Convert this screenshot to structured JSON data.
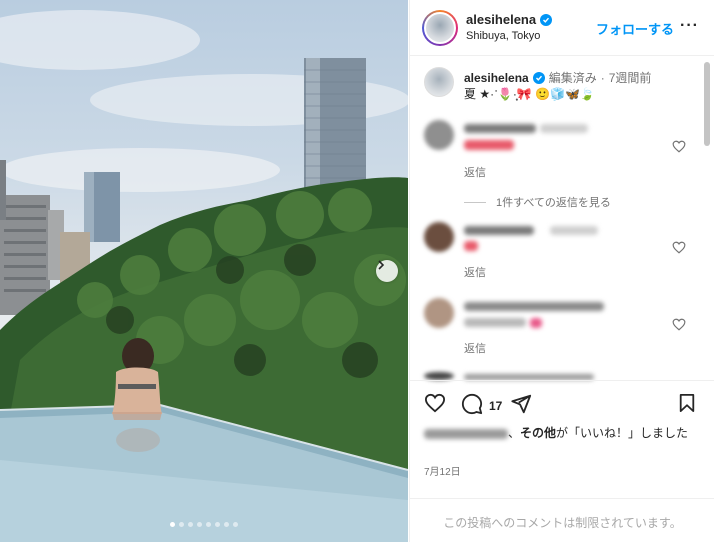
{
  "post": {
    "username": "alesihelena",
    "location": "Shibuya, Tokyo",
    "follow_label": "フォローする",
    "more_label": "···"
  },
  "caption": {
    "username": "alesihelena",
    "edited": "編集済み",
    "separator": "·",
    "time_ago": "7週間前",
    "text": "夏 ★·ॱ🌷·̩͙🎀 🙂🧊🦋🍃"
  },
  "comments": {
    "reply_label": "返信",
    "view_replies_label": "1件すべての返信を見る"
  },
  "actions": {
    "comment_count": "17",
    "likes_suffix_1": "、",
    "likes_others": "その他",
    "likes_suffix_2": "が「いいね！」しました",
    "date": "7月12日"
  },
  "footer": {
    "comments_restricted": "この投稿へのコメントは制限されています。"
  },
  "carousel": {
    "slide_count": 8,
    "active_index": 0
  },
  "colors": {
    "accent": "#0095f6",
    "like_heart": "#ed4956"
  }
}
